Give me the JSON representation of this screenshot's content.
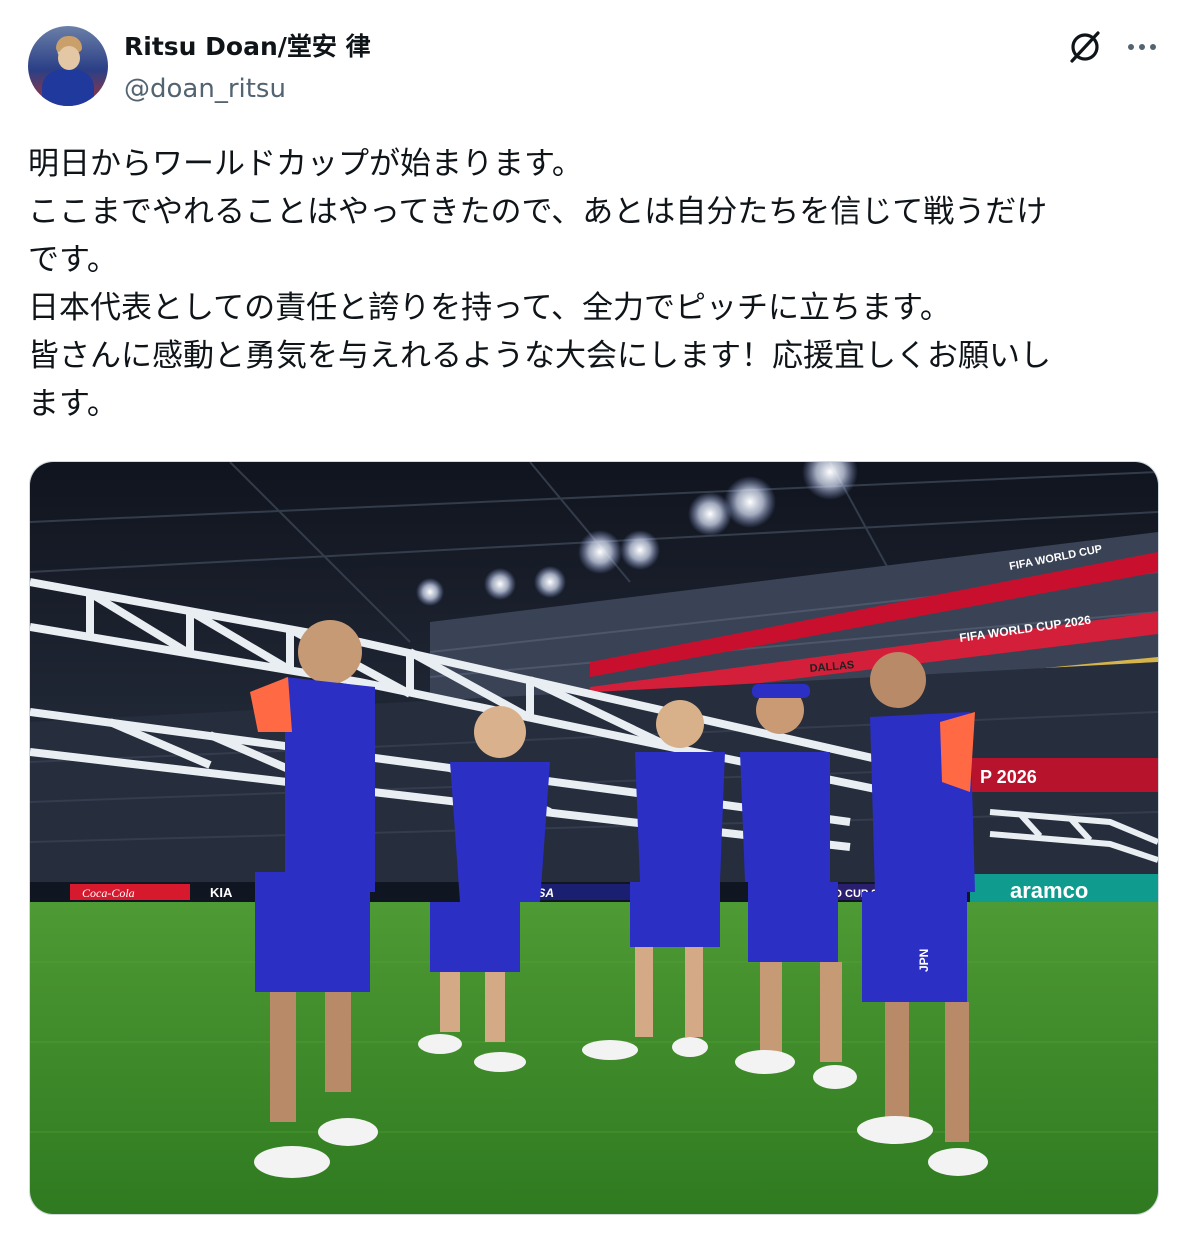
{
  "author": {
    "display_name": "Ritsu Doan/堂安 律",
    "handle": "@doan_ritsu"
  },
  "icons": {
    "grok": "grok-icon",
    "more": "more-options-icon"
  },
  "tweet": {
    "lines": [
      "明日からワールドカップが始まります。",
      "ここまでやれることはやってきたので、あとは自分たちを信じて戦うだけ",
      "です。",
      "日本代表としての責任と誇りを持って、全力でピッチに立ちます。",
      "皆さんに感動と勇気を与えれるような大会にします！応援宜しくお願いし",
      "ます。"
    ]
  },
  "photo": {
    "signage": {
      "fifa_top": "FIFA WORLD CUP",
      "fifa_mid": "FIFA WORLD CUP 2026",
      "dallas": "DALLAS",
      "cup2026": "P 2026",
      "aramco": "aramco",
      "cocacola": "Coca-Cola",
      "kia": "KIA",
      "visa": "VISA",
      "cup_small": "D CUP 2"
    },
    "kit_text": "JPN"
  },
  "colors": {
    "kit_blue": "#2b2fc4",
    "kit_orange": "#ff6a45",
    "pitch": "#3f8f2a",
    "stand": "#2a3142",
    "truss": "#e9eef3"
  }
}
